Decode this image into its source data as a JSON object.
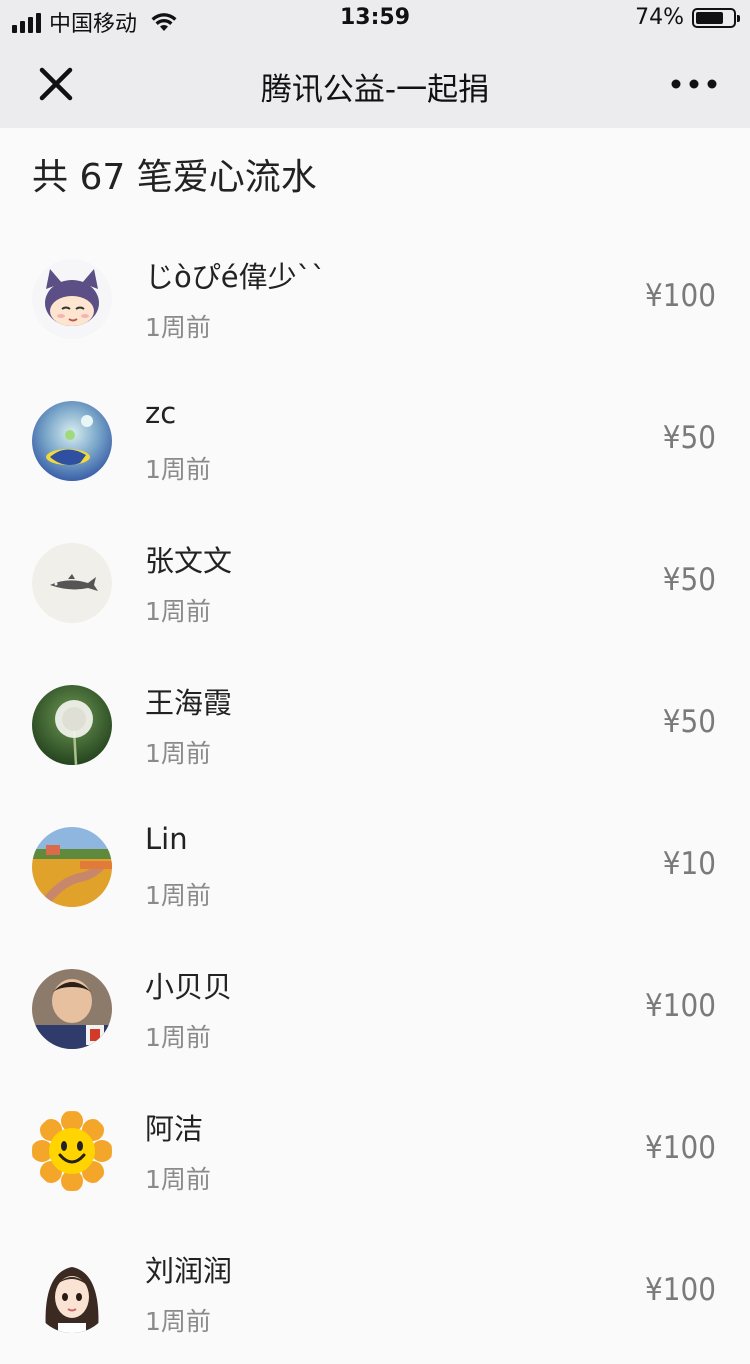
{
  "status_bar": {
    "carrier": "中国移动",
    "time": "13:59",
    "battery_percent": "74%",
    "battery_level": 0.74
  },
  "nav": {
    "title": "腾讯公益-一起捐",
    "close_icon": "close-icon",
    "more_icon": "more-icon"
  },
  "summary": "共 67 笔爱心流水",
  "donations": [
    {
      "name": "じòぴé偉少``",
      "time": "1周前",
      "amount": "¥100",
      "avatar": "cat-ear-boy-avatar"
    },
    {
      "name": "zc",
      "time": "1周前",
      "amount": "¥50",
      "avatar": "bird-avatar"
    },
    {
      "name": "张文文",
      "time": "1周前",
      "amount": "¥50",
      "avatar": "fish-ink-avatar"
    },
    {
      "name": "王海霞",
      "time": "1周前",
      "amount": "¥50",
      "avatar": "dandelion-avatar"
    },
    {
      "name": "Lin",
      "time": "1周前",
      "amount": "¥10",
      "avatar": "landscape-painting-avatar"
    },
    {
      "name": "小贝贝",
      "time": "1周前",
      "amount": "¥100",
      "avatar": "child-photo-avatar"
    },
    {
      "name": "阿洁",
      "time": "1周前",
      "amount": "¥100",
      "avatar": "sunflower-smiley-avatar"
    },
    {
      "name": "刘润润",
      "time": "1周前",
      "amount": "¥100",
      "avatar": "cartoon-girl-avatar"
    }
  ],
  "colors": {
    "bar_background": "#ececef",
    "page_background": "#fafafa",
    "amount_text": "#7a7a7a",
    "secondary_text": "#8a8a8a"
  }
}
